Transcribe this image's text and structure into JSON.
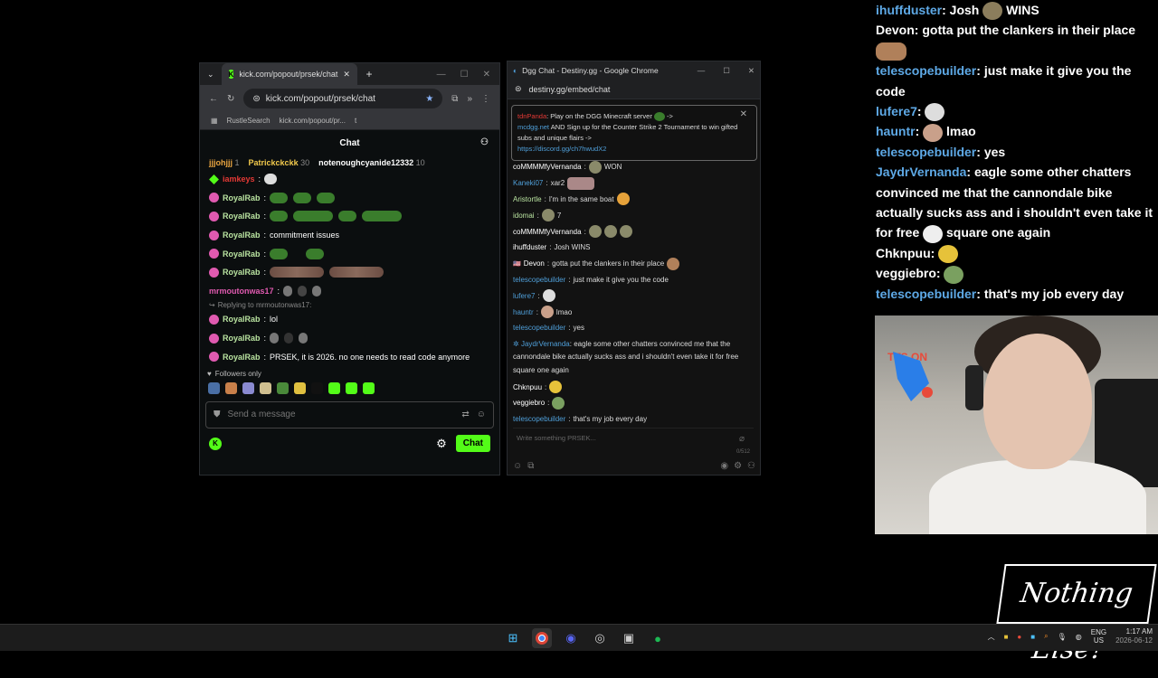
{
  "kick": {
    "tab_title": "kick.com/popout/prsek/chat",
    "url": "kick.com/popout/prsek/chat",
    "bookmarks": [
      "RustleSearch",
      "kick.com/popout/pr...",
      "t"
    ],
    "chat_header": "Chat",
    "gifters": [
      {
        "name": "jjjohjjj",
        "count": "1"
      },
      {
        "name": "Patrickckckk",
        "count": "30"
      },
      {
        "name": "notenoughcyanide12332",
        "count": "10"
      }
    ],
    "messages": [
      {
        "user": "iamkeys",
        "text": ""
      },
      {
        "user": "RoyalRab",
        "text": ""
      },
      {
        "user": "RoyalRab",
        "text": ""
      },
      {
        "user": "RoyalRab",
        "text": "commitment issues"
      },
      {
        "user": "RoyalRab",
        "text": ""
      },
      {
        "user": "RoyalRab",
        "text": ""
      },
      {
        "user": "mrmoutonwas17",
        "text": ""
      },
      {
        "user": "RoyalRab",
        "text": "lol",
        "reply": "Replying to mrmoutonwas17:"
      },
      {
        "user": "RoyalRab",
        "text": ""
      },
      {
        "user": "RoyalRab",
        "text": "PRSEK, it is 2026. no one needs to read code anymore"
      }
    ],
    "followers_only": "Followers only",
    "input_placeholder": "Send a message",
    "chat_button": "Chat"
  },
  "dgg": {
    "window_title": "Dgg Chat - Destiny.gg - Google Chrome",
    "url": "destiny.gg/embed/chat",
    "pinned": {
      "user": "tdnPanda",
      "line1": ": Play on the DGG Minecraft server",
      "link1": "mcdgg.net",
      "line2": "AND Sign up for the Counter Strike 2 Tournament to win gifted subs and unique flairs",
      "link2": "https://discord.gg/ch7hwudX2"
    },
    "messages": [
      {
        "user": "coMMMMfyVernanda",
        "text": "WON"
      },
      {
        "user": "Kaneki07",
        "text": "xar2"
      },
      {
        "user": "Aristortle",
        "text": "I'm in the same boat"
      },
      {
        "user": "idomai",
        "text": "7"
      },
      {
        "user": "coMMMMfyVernanda",
        "text": ""
      },
      {
        "user": "ihuffduster",
        "text": "Josh WINS"
      },
      {
        "user": "Devon",
        "text": "gotta put the clankers in their place"
      },
      {
        "user": "telescopebuilder",
        "text": "just make it give you the code"
      },
      {
        "user": "lufere7",
        "text": ""
      },
      {
        "user": "hauntr",
        "text": "lmao"
      },
      {
        "user": "telescopebuilder",
        "text": "yes"
      },
      {
        "user": "JaydrVernanda",
        "text": "eagle some other chatters convinced me that the cannondale bike actually sucks ass and i shouldn't even take it for free square one again"
      },
      {
        "user": "Chknpuu",
        "text": ""
      },
      {
        "user": "veggiebro",
        "text": ""
      },
      {
        "user": "telescopebuilder",
        "text": "that's my job every day"
      }
    ],
    "input_placeholder": "Write something PRSEK...",
    "char_count": "0/512"
  },
  "overlay": {
    "messages": [
      {
        "user": "ihuffduster",
        "text": "Josh",
        "extra": "WINS"
      },
      {
        "user": "Devon",
        "text": "gotta put the clankers in their place"
      },
      {
        "user": "telescopebuilder",
        "text": "just make it give you the code"
      },
      {
        "user": "lufere7",
        "text": ""
      },
      {
        "user": "hauntr",
        "text": "lmao"
      },
      {
        "user": "telescopebuilder",
        "text": "yes"
      },
      {
        "user": "JaydrVernanda",
        "text": "eagle some other chatters convinced me that the cannondale bike actually sucks ass and i shouldn't even take it for free",
        "extra": "square one again"
      },
      {
        "user": "Chknpuu",
        "text": ""
      },
      {
        "user": "veggiebro",
        "text": ""
      },
      {
        "user": "telescopebuilder",
        "text": "that's my job every day"
      }
    ]
  },
  "webcam": {
    "tts_label": "TTS ON"
  },
  "logo_text": "Nothing Else?",
  "taskbar": {
    "lang": "ENG",
    "region": "US",
    "time": "1:17 AM",
    "date": "2026-06-12"
  },
  "colors": {
    "kick_green": "#53fc18",
    "dgg_blue": "#4f9fd9",
    "royal_pink": "#e05ab0"
  }
}
